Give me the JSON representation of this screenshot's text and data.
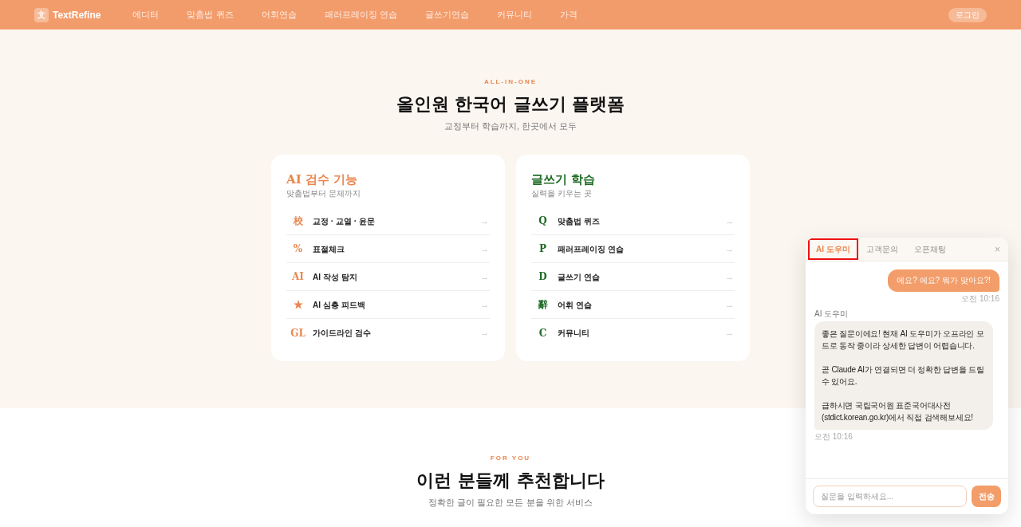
{
  "navbar": {
    "logo_glyph": "文",
    "brand": "TextRefine",
    "links": [
      "에디터",
      "맞춤법 퀴즈",
      "어휘연습",
      "패러프레이징 연습",
      "글쓰기연습",
      "커뮤니티",
      "가격"
    ],
    "login_button": "로그인"
  },
  "hero": {
    "eyebrow": "ALL-IN-ONE",
    "title": "올인원 한국어 글쓰기 플랫폼",
    "subtitle": "교정부터 학습까지, 한곳에서 모두"
  },
  "cards": [
    {
      "title": "AI 검수 기능",
      "subtitle": "맞춤법부터 문체까지",
      "color": "#e8874f",
      "items": [
        {
          "icon": "校",
          "label": "교정 · 교열 · 윤문",
          "arrow": "→"
        },
        {
          "icon": "%",
          "label": "표절체크",
          "arrow": "→"
        },
        {
          "icon": "AI",
          "label": "AI 작성 탐지",
          "arrow": "→"
        },
        {
          "icon": "★",
          "label": "AI 심층 피드백",
          "arrow": "→"
        },
        {
          "icon": "GL",
          "label": "가이드라인 검수",
          "arrow": "→"
        }
      ]
    },
    {
      "title": "글쓰기 학습",
      "subtitle": "실력을 키우는 곳",
      "color": "#1f6b26",
      "items": [
        {
          "icon": "Q",
          "label": "맞춤법 퀴즈",
          "arrow": "→"
        },
        {
          "icon": "P",
          "label": "패러프레이징 연습",
          "arrow": "→"
        },
        {
          "icon": "D",
          "label": "글쓰기 연습",
          "arrow": "→"
        },
        {
          "icon": "辭",
          "label": "어휘 연습",
          "arrow": "→"
        },
        {
          "icon": "C",
          "label": "커뮤니티",
          "arrow": "→"
        }
      ]
    }
  ],
  "recommend": {
    "eyebrow": "FOR YOU",
    "title": "이런 분들께 추천합니다",
    "subtitle": "정확한 글이 필요한 모든 분을 위한 서비스"
  },
  "chat": {
    "tabs": [
      {
        "label": "AI 도우미",
        "selected": true,
        "marked": true
      },
      {
        "label": "고객문의",
        "selected": false,
        "marked": false
      },
      {
        "label": "오픈채팅",
        "selected": false,
        "marked": false
      }
    ],
    "close": "×",
    "messages": [
      {
        "kind": "user",
        "text": "에요? 에요? 뭐가 맞아요?!",
        "time": "오전 10:16"
      },
      {
        "kind": "bot",
        "sender": "AI 도우미",
        "text": "좋은 질문이에요! 현재 AI 도우미가 오프라인 모드로 동작 중이라 상세한 답변이 어렵습니다.\n\n곧 Claude AI가 연결되면 더 정확한 답변을 드릴 수 있어요.\n\n급하시면 국립국어원 표준국어대사전(stdict.korean.go.kr)에서 직접 검색해보세요!",
        "time": "오전 10:16"
      }
    ],
    "input": {
      "placeholder": "질문을 입력하세요..."
    },
    "send_button": "전송"
  }
}
